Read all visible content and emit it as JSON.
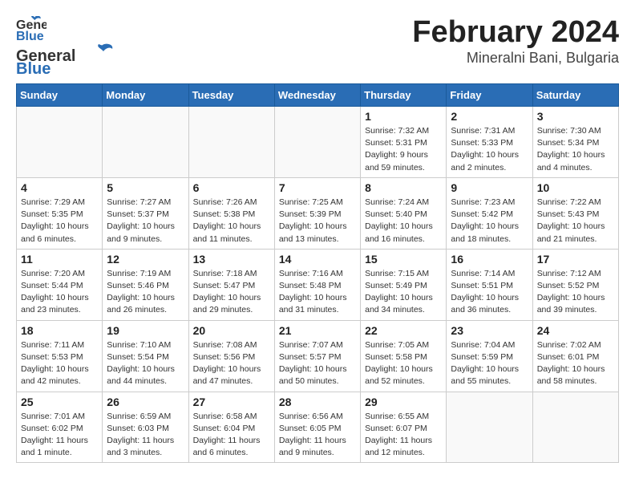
{
  "header": {
    "logo_general": "General",
    "logo_blue": "Blue",
    "month": "February 2024",
    "location": "Mineralni Bani, Bulgaria"
  },
  "weekdays": [
    "Sunday",
    "Monday",
    "Tuesday",
    "Wednesday",
    "Thursday",
    "Friday",
    "Saturday"
  ],
  "weeks": [
    [
      {
        "day": "",
        "info": ""
      },
      {
        "day": "",
        "info": ""
      },
      {
        "day": "",
        "info": ""
      },
      {
        "day": "",
        "info": ""
      },
      {
        "day": "1",
        "info": "Sunrise: 7:32 AM\nSunset: 5:31 PM\nDaylight: 9 hours and 59 minutes."
      },
      {
        "day": "2",
        "info": "Sunrise: 7:31 AM\nSunset: 5:33 PM\nDaylight: 10 hours and 2 minutes."
      },
      {
        "day": "3",
        "info": "Sunrise: 7:30 AM\nSunset: 5:34 PM\nDaylight: 10 hours and 4 minutes."
      }
    ],
    [
      {
        "day": "4",
        "info": "Sunrise: 7:29 AM\nSunset: 5:35 PM\nDaylight: 10 hours and 6 minutes."
      },
      {
        "day": "5",
        "info": "Sunrise: 7:27 AM\nSunset: 5:37 PM\nDaylight: 10 hours and 9 minutes."
      },
      {
        "day": "6",
        "info": "Sunrise: 7:26 AM\nSunset: 5:38 PM\nDaylight: 10 hours and 11 minutes."
      },
      {
        "day": "7",
        "info": "Sunrise: 7:25 AM\nSunset: 5:39 PM\nDaylight: 10 hours and 13 minutes."
      },
      {
        "day": "8",
        "info": "Sunrise: 7:24 AM\nSunset: 5:40 PM\nDaylight: 10 hours and 16 minutes."
      },
      {
        "day": "9",
        "info": "Sunrise: 7:23 AM\nSunset: 5:42 PM\nDaylight: 10 hours and 18 minutes."
      },
      {
        "day": "10",
        "info": "Sunrise: 7:22 AM\nSunset: 5:43 PM\nDaylight: 10 hours and 21 minutes."
      }
    ],
    [
      {
        "day": "11",
        "info": "Sunrise: 7:20 AM\nSunset: 5:44 PM\nDaylight: 10 hours and 23 minutes."
      },
      {
        "day": "12",
        "info": "Sunrise: 7:19 AM\nSunset: 5:46 PM\nDaylight: 10 hours and 26 minutes."
      },
      {
        "day": "13",
        "info": "Sunrise: 7:18 AM\nSunset: 5:47 PM\nDaylight: 10 hours and 29 minutes."
      },
      {
        "day": "14",
        "info": "Sunrise: 7:16 AM\nSunset: 5:48 PM\nDaylight: 10 hours and 31 minutes."
      },
      {
        "day": "15",
        "info": "Sunrise: 7:15 AM\nSunset: 5:49 PM\nDaylight: 10 hours and 34 minutes."
      },
      {
        "day": "16",
        "info": "Sunrise: 7:14 AM\nSunset: 5:51 PM\nDaylight: 10 hours and 36 minutes."
      },
      {
        "day": "17",
        "info": "Sunrise: 7:12 AM\nSunset: 5:52 PM\nDaylight: 10 hours and 39 minutes."
      }
    ],
    [
      {
        "day": "18",
        "info": "Sunrise: 7:11 AM\nSunset: 5:53 PM\nDaylight: 10 hours and 42 minutes."
      },
      {
        "day": "19",
        "info": "Sunrise: 7:10 AM\nSunset: 5:54 PM\nDaylight: 10 hours and 44 minutes."
      },
      {
        "day": "20",
        "info": "Sunrise: 7:08 AM\nSunset: 5:56 PM\nDaylight: 10 hours and 47 minutes."
      },
      {
        "day": "21",
        "info": "Sunrise: 7:07 AM\nSunset: 5:57 PM\nDaylight: 10 hours and 50 minutes."
      },
      {
        "day": "22",
        "info": "Sunrise: 7:05 AM\nSunset: 5:58 PM\nDaylight: 10 hours and 52 minutes."
      },
      {
        "day": "23",
        "info": "Sunrise: 7:04 AM\nSunset: 5:59 PM\nDaylight: 10 hours and 55 minutes."
      },
      {
        "day": "24",
        "info": "Sunrise: 7:02 AM\nSunset: 6:01 PM\nDaylight: 10 hours and 58 minutes."
      }
    ],
    [
      {
        "day": "25",
        "info": "Sunrise: 7:01 AM\nSunset: 6:02 PM\nDaylight: 11 hours and 1 minute."
      },
      {
        "day": "26",
        "info": "Sunrise: 6:59 AM\nSunset: 6:03 PM\nDaylight: 11 hours and 3 minutes."
      },
      {
        "day": "27",
        "info": "Sunrise: 6:58 AM\nSunset: 6:04 PM\nDaylight: 11 hours and 6 minutes."
      },
      {
        "day": "28",
        "info": "Sunrise: 6:56 AM\nSunset: 6:05 PM\nDaylight: 11 hours and 9 minutes."
      },
      {
        "day": "29",
        "info": "Sunrise: 6:55 AM\nSunset: 6:07 PM\nDaylight: 11 hours and 12 minutes."
      },
      {
        "day": "",
        "info": ""
      },
      {
        "day": "",
        "info": ""
      }
    ]
  ]
}
